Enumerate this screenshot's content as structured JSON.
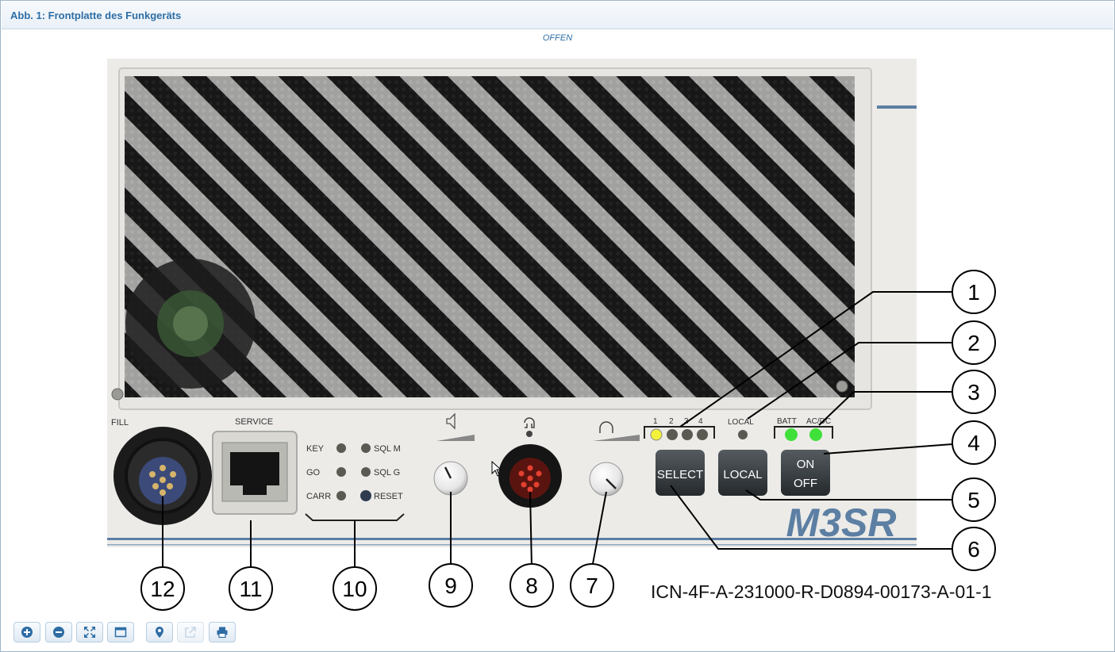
{
  "window": {
    "title": "Abb. 1: Frontplatte des Funkgeräts",
    "classification": "OFFEN"
  },
  "figure": {
    "icn": "ICN-4F-A-231000-R-D0894-00173-A-01-1",
    "panel_labels": {
      "fill": "FILL",
      "service": "SERVICE",
      "key": "KEY",
      "go": "GO",
      "carr": "CARR",
      "sqlm": "SQL M",
      "sqlg": "SQL G",
      "reset": "RESET",
      "local_led": "LOCAL",
      "batt": "BATT",
      "acdc": "AC/DC",
      "sel_1": "1",
      "sel_2": "2",
      "sel_3": "3",
      "sel_4": "4",
      "select_button": "SELECT",
      "local_button": "LOCAL",
      "on": "ON",
      "off": "OFF",
      "brand": "M3SR"
    },
    "callouts": [
      {
        "n": "1"
      },
      {
        "n": "2"
      },
      {
        "n": "3"
      },
      {
        "n": "4"
      },
      {
        "n": "5"
      },
      {
        "n": "6"
      },
      {
        "n": "7"
      },
      {
        "n": "8"
      },
      {
        "n": "9"
      },
      {
        "n": "10"
      },
      {
        "n": "11"
      },
      {
        "n": "12"
      }
    ],
    "colors": {
      "led_yellow": "#f2f23a",
      "led_green": "#3fe03a",
      "led_off": "#5a5a52",
      "accent_blue": "#5c7fa3"
    }
  },
  "toolbar": {
    "buttons": [
      {
        "icon": "zoom-in-icon"
      },
      {
        "icon": "zoom-out-icon"
      },
      {
        "icon": "fit-to-screen-icon"
      },
      {
        "icon": "window-icon"
      },
      {
        "icon": "location-pin-icon"
      },
      {
        "icon": "open-external-icon"
      },
      {
        "icon": "print-icon"
      }
    ]
  }
}
